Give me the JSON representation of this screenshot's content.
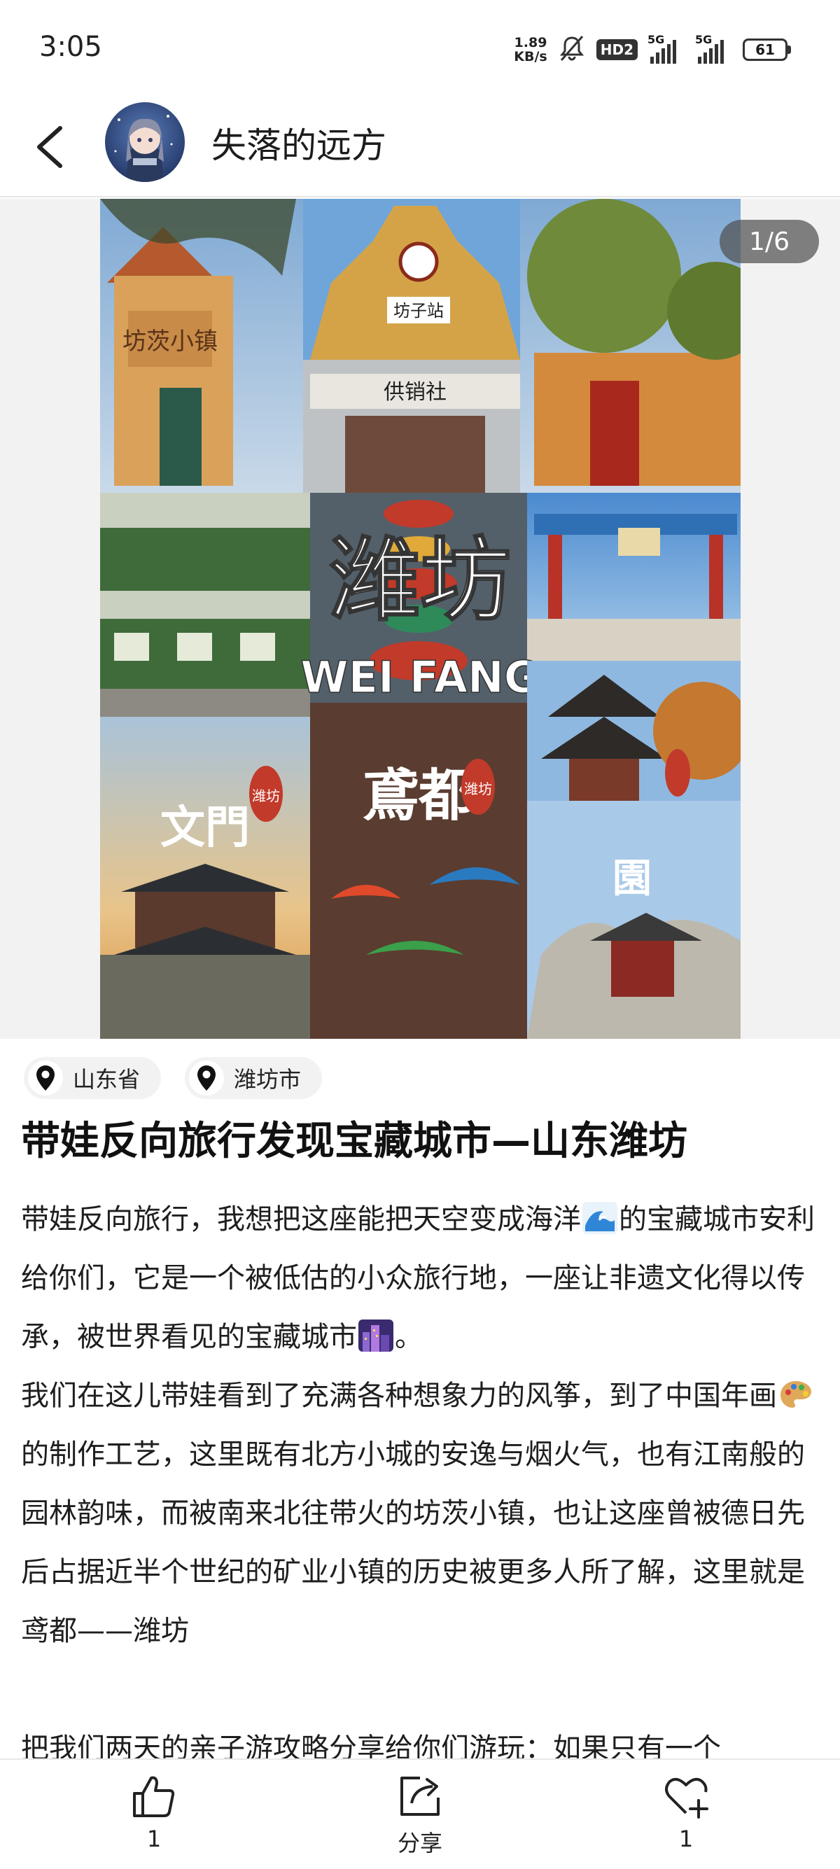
{
  "status_bar": {
    "time": "3:05",
    "net_speed_value": "1.89",
    "net_speed_unit": "KB/s",
    "hd_label": "HD2",
    "sim1_label": "5G",
    "sim2_label": "5G",
    "battery": "61"
  },
  "header": {
    "author_name": "失落的远方"
  },
  "gallery": {
    "page_indicator": "1/6",
    "poster": {
      "title": "潍坊",
      "subtitle": "WEI FANG",
      "sign_station": "坊子站",
      "sign_coop": "供销社",
      "sign_town": "坊茨小镇",
      "label_left": "文門",
      "label_mid": "鳶都",
      "label_right": "園",
      "seal": "潍坊"
    }
  },
  "location_tags": [
    {
      "label": "山东省"
    },
    {
      "label": "潍坊市"
    }
  ],
  "post": {
    "title": "带娃反向旅行发现宝藏城市—山东潍坊",
    "p1_a": "带娃反向旅行，我想把这座能把天空变成海洋",
    "p1_b": "的宝藏城市安利给你们，它是一个被低估的小众旅行地，一座让非遗文化得以传承，被世界看见的宝藏城市",
    "p1_c": "。",
    "p2_a": "我们在这儿带娃看到了充满各种想象力的风筝，到了中国年画",
    "p2_b": "的制作工艺，这里既有北方小城的安逸与烟火气，也有江南般的园林韵味，而被南来北往带火的坊茨小镇，也让这座曾被德日先后占据近半个世纪的矿业小镇的历史被更多人所了解，这里就是鸢都——潍坊",
    "p3": "把我们两天的亲子游攻略分享给你们游玩：如果只有一个"
  },
  "bottom_bar": {
    "like_count": "1",
    "share_label": "分享",
    "favorite_count": "1"
  },
  "colors": {
    "accent": "#1a1a1a",
    "tag_bg": "#f2f2f2",
    "indicator_bg": "#505050"
  }
}
